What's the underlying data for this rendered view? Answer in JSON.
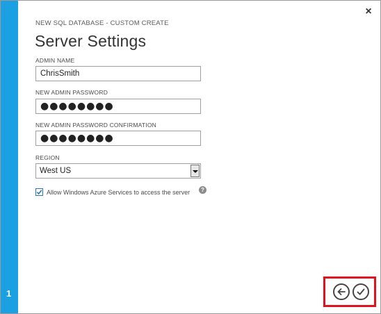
{
  "wizard": {
    "subtitle": "NEW SQL DATABASE - CUSTOM CREATE",
    "title": "Server Settings",
    "step_number": "1"
  },
  "fields": {
    "admin_name": {
      "label": "ADMIN NAME",
      "value": "ChrisSmith"
    },
    "admin_password": {
      "label": "NEW ADMIN PASSWORD",
      "value": "●●●●●●●●"
    },
    "admin_password_confirm": {
      "label": "NEW ADMIN PASSWORD CONFIRMATION",
      "value": "●●●●●●●●"
    },
    "region": {
      "label": "REGION",
      "value": "West US"
    }
  },
  "allow_azure": {
    "label": "Allow Windows Azure Services to access the server",
    "checked": true
  },
  "help_glyph": "?",
  "close_glyph": "×",
  "colors": {
    "step_rail": "#1ba1e2",
    "highlight": "#e0121e",
    "checkbox_accent": "#2c74b6"
  },
  "icons": {
    "close": "close-icon",
    "back": "arrow-left-icon",
    "complete": "checkmark-icon",
    "help": "help-icon",
    "dropdown": "chevron-down-icon"
  }
}
